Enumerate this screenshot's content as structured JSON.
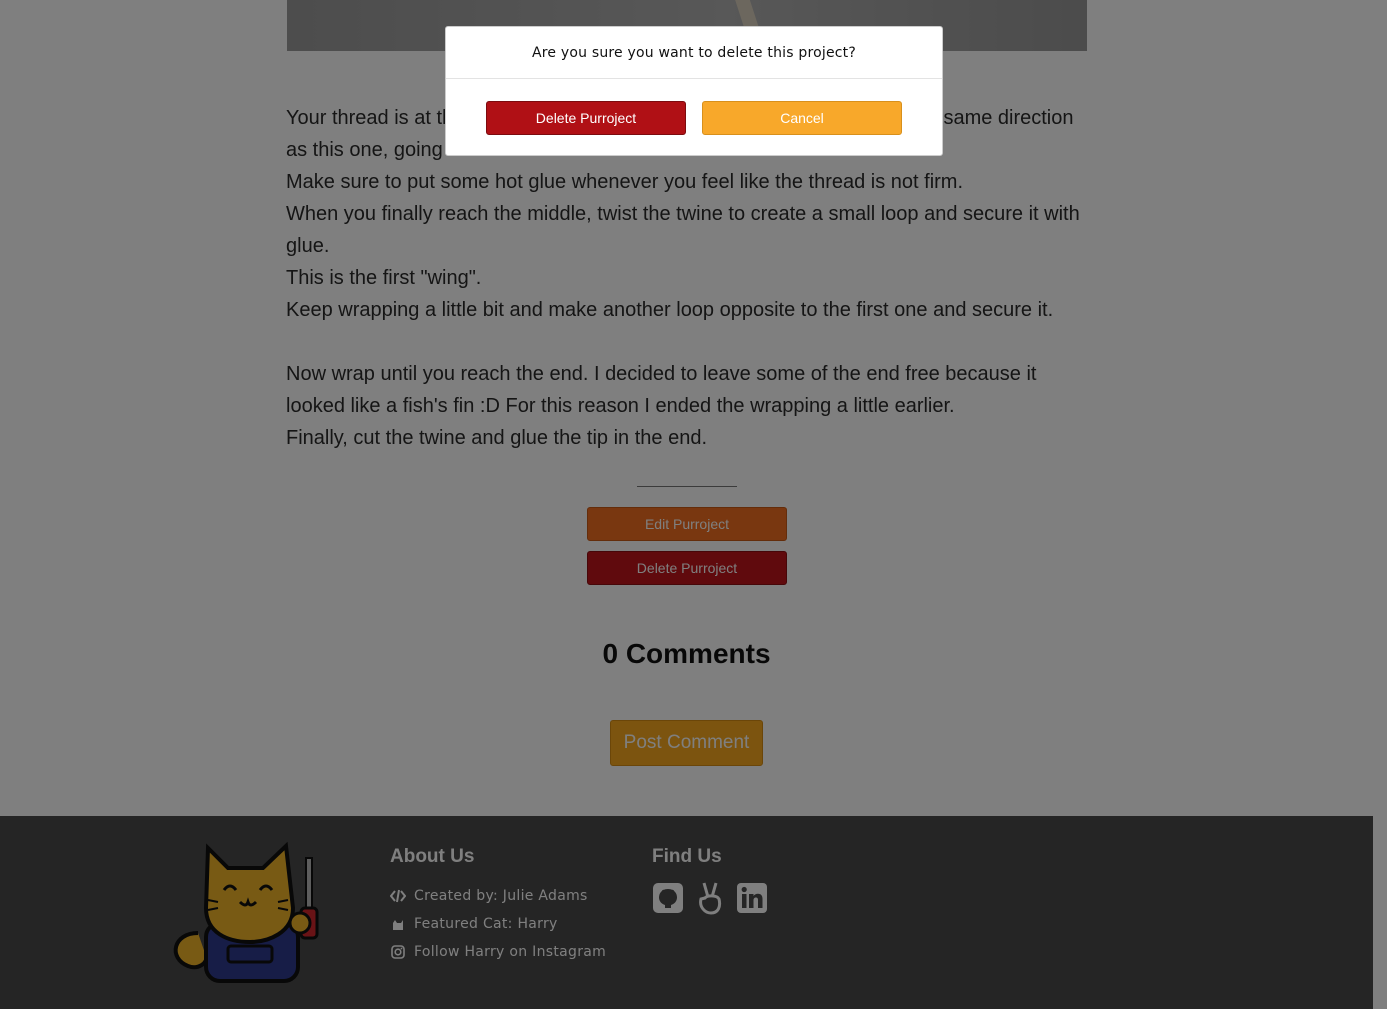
{
  "article": {
    "paragraphs": [
      "Your thread is at the beginning of the stick. Start wrapping the twine in the same direction as this one, going from the end to the middle this time.",
      "Make sure to put some hot glue whenever you feel like the thread is not firm.",
      "When you finally reach the middle, twist the twine to create a small loop and secure it with glue.",
      "This is the first \"wing\".",
      "Keep wrapping a little bit and make another loop opposite to the first one and secure it.",
      "",
      "Now wrap until you reach the end. I decided to leave some of the end free because it looked like a fish's fin :D For this reason I ended the wrapping a little earlier.",
      "Finally, cut the twine and glue the tip in the end."
    ]
  },
  "actions": {
    "edit_label": "Edit Purroject",
    "delete_label": "Delete Purroject"
  },
  "comments": {
    "title": "0 Comments",
    "post_label": "Post Comment"
  },
  "footer": {
    "about_title": "About Us",
    "about_items": [
      {
        "icon": "code-icon",
        "text": "Created by: Julie Adams"
      },
      {
        "icon": "cat-icon",
        "text": "Featured Cat: Harry"
      },
      {
        "icon": "instagram-icon",
        "text": "Follow Harry on Instagram"
      }
    ],
    "find_title": "Find Us",
    "social_icons": [
      "github-icon",
      "angellist-icon",
      "linkedin-icon"
    ]
  },
  "modal": {
    "question": "Are you sure you want to delete this project?",
    "delete_label": "Delete Purroject",
    "cancel_label": "Cancel"
  },
  "colors": {
    "edit_button": "#f36f21",
    "delete_button": "#c0141a",
    "post_button": "#f8a91f",
    "modal_delete": "#b01015",
    "modal_cancel": "#f8a82a",
    "footer_bg": "#4a4a4a"
  }
}
